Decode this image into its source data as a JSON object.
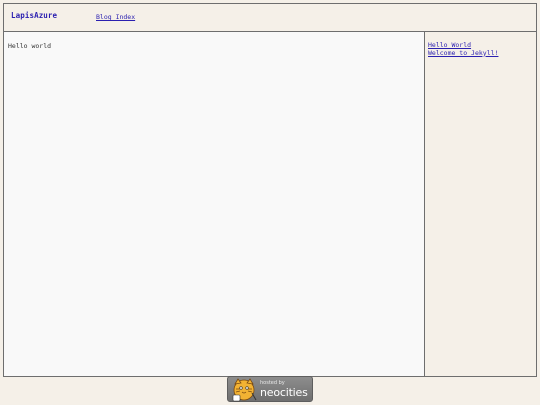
{
  "header": {
    "site_title": "LapisAzure",
    "nav": [
      {
        "label": "Blog Index"
      }
    ]
  },
  "main": {
    "content": "Hello world"
  },
  "sidebar": {
    "posts": [
      {
        "label": "Hello World"
      },
      {
        "label": "Welcome to Jekyll!"
      }
    ]
  },
  "footer": {
    "badge_small": "hosted by",
    "badge_big": "neocities"
  },
  "colors": {
    "link": "#2a1fb0",
    "background": "#f5f0e8",
    "main_background": "#f9f9f9",
    "border": "#6e6e6e"
  }
}
